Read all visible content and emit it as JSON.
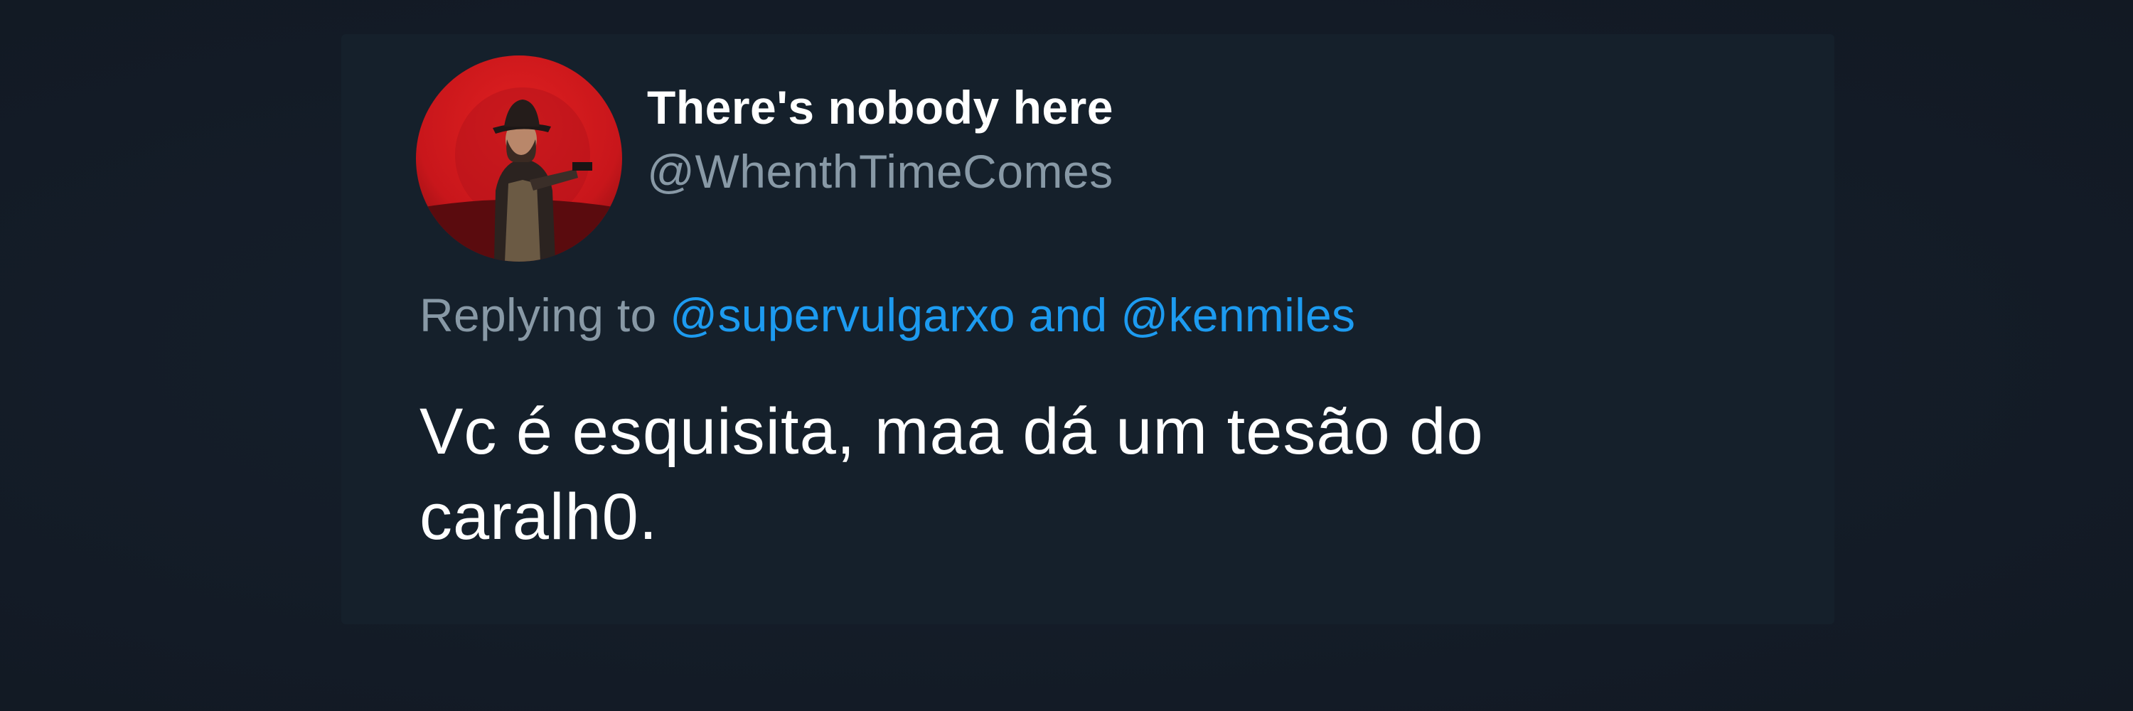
{
  "theme": {
    "background": "#15202b",
    "text_primary": "#ffffff",
    "text_secondary": "#8899a6",
    "link": "#1d9bf0",
    "avatar_bg": "#c8161b"
  },
  "tweet": {
    "avatar_icon": "user-avatar-gunslinger",
    "display_name": "There's nobody here",
    "handle": "@WhenthTimeComes",
    "reply": {
      "prefix": "Replying to",
      "mention_1": "@supervulgarxo",
      "conjunction": "and",
      "mention_2": "@kenmiles"
    },
    "text_lines": [
      "Vc é esquisita, maa dá um tesão do",
      "caralh0."
    ]
  }
}
